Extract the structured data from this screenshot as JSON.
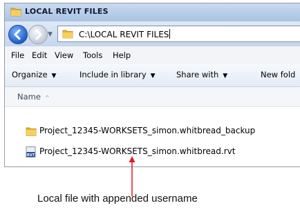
{
  "window": {
    "title": "LOCAL REVIT FILES"
  },
  "address": {
    "path": "C:\\LOCAL REVIT FILES"
  },
  "menu": {
    "file": "File",
    "edit": "Edit",
    "view": "View",
    "tools": "Tools",
    "help": "Help"
  },
  "commands": {
    "organize": "Organize",
    "include_in_library": "Include in library",
    "share_with": "Share with",
    "new_folder": "New fold"
  },
  "columns": {
    "name": "Name"
  },
  "files": [
    {
      "name": "Project_12345-WORKSETS_simon.whitbread_backup",
      "icon": "folder-icon"
    },
    {
      "name": "Project_12345-WORKSETS_simon.whitbread.rvt",
      "icon": "revit-file-icon",
      "icon_text": "RVT"
    }
  ],
  "annotation": {
    "text": "Local file with appended username",
    "color": "#e0191e"
  }
}
